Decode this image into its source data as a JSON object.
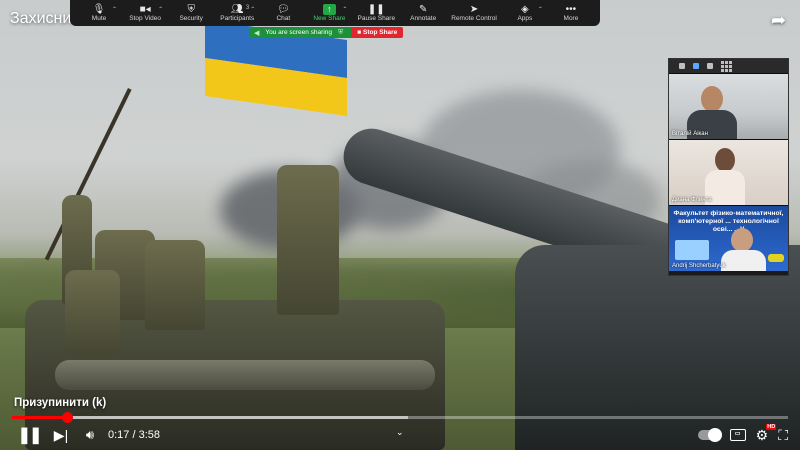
{
  "zoom_toolbar": {
    "items": [
      {
        "label": "Mute",
        "icon": "microphone-icon"
      },
      {
        "label": "Stop Video",
        "icon": "video-camera-icon"
      },
      {
        "label": "Security",
        "icon": "shield-icon"
      },
      {
        "label": "Participants",
        "icon": "participants-icon",
        "count": "3"
      },
      {
        "label": "Chat",
        "icon": "chat-icon"
      },
      {
        "label": "New Share",
        "icon": "share-screen-icon"
      },
      {
        "label": "Pause Share",
        "icon": "pause-icon"
      },
      {
        "label": "Annotate",
        "icon": "pencil-icon"
      },
      {
        "label": "Remote Control",
        "icon": "cursor-icon"
      },
      {
        "label": "Apps",
        "icon": "apps-icon"
      },
      {
        "label": "More",
        "icon": "more-icon"
      }
    ]
  },
  "share_status": {
    "sharing_text": "You are screen sharing",
    "stop_label": "Stop Share"
  },
  "video": {
    "title": "Захисник",
    "paused_tooltip": "Призупинити (k)",
    "current_time": "0:17",
    "duration": "3:58",
    "time_display": "0:17 / 3:58",
    "progress_fraction": 0.071,
    "buffered_fraction": 0.51,
    "quality_badge": "HD"
  },
  "participants_panel": {
    "participants": [
      {
        "name": "Віталій Аікан"
      },
      {
        "name": "Диана Флинта"
      },
      {
        "name": "Andrij Shcherbatyuk",
        "shared_text": "Факультет фізико-математичної, комп'ютерної ... технологічної осві... ...У"
      }
    ]
  },
  "colors": {
    "progress_played": "#ff0000",
    "share_green": "#1e8f3a",
    "stop_share_red": "#e0262e",
    "new_share_green": "#21a845"
  }
}
